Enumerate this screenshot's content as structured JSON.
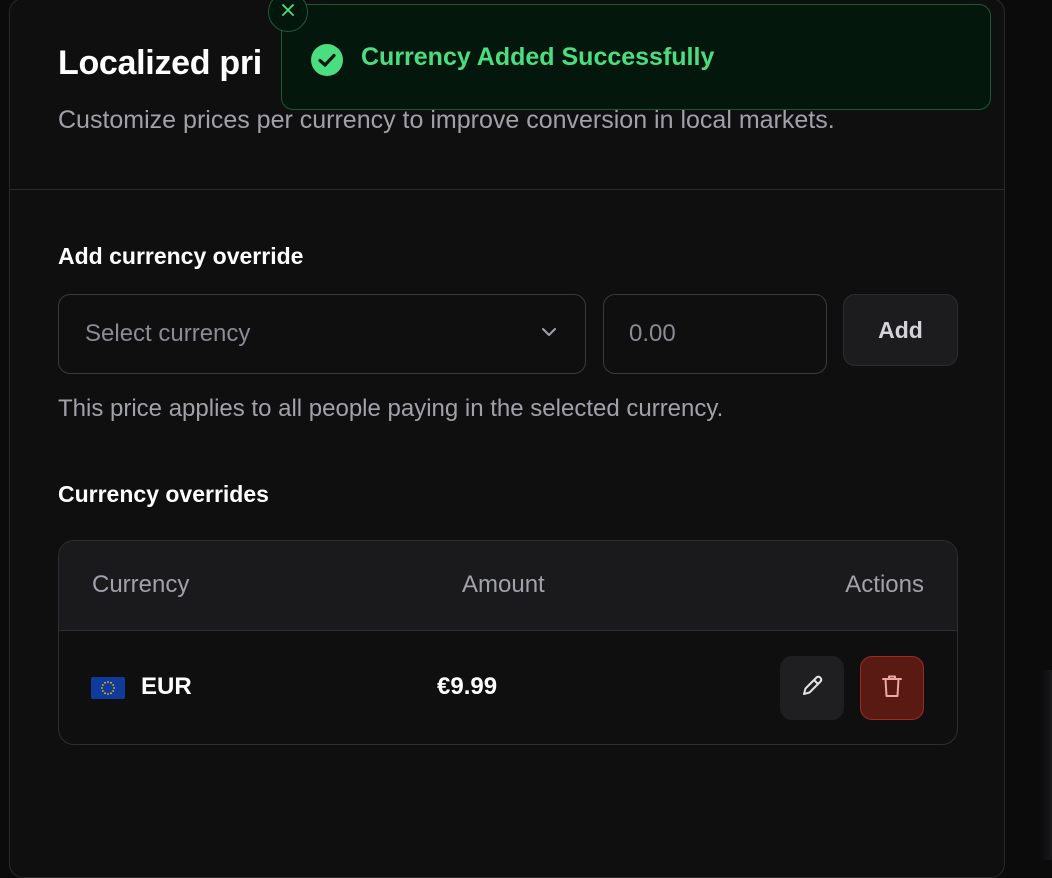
{
  "header": {
    "title": "Localized pri",
    "subtitle": "Customize prices per currency to improve conversion in local markets."
  },
  "add_override": {
    "label": "Add currency override",
    "select_placeholder": "Select currency",
    "amount_placeholder": "0.00",
    "add_label": "Add",
    "helper": "This price applies to all people paying in the selected currency."
  },
  "overrides": {
    "label": "Currency overrides",
    "columns": [
      "Currency",
      "Amount",
      "Actions"
    ],
    "rows": [
      {
        "flag": "eu-flag-icon",
        "currency": "EUR",
        "amount": "€9.99"
      }
    ]
  },
  "toast": {
    "message": "Currency Added Successfully"
  },
  "colors": {
    "success": "#4ade80",
    "danger": "#9a2d22",
    "eu_blue": "#103a9c",
    "eu_star": "#f5c400"
  }
}
